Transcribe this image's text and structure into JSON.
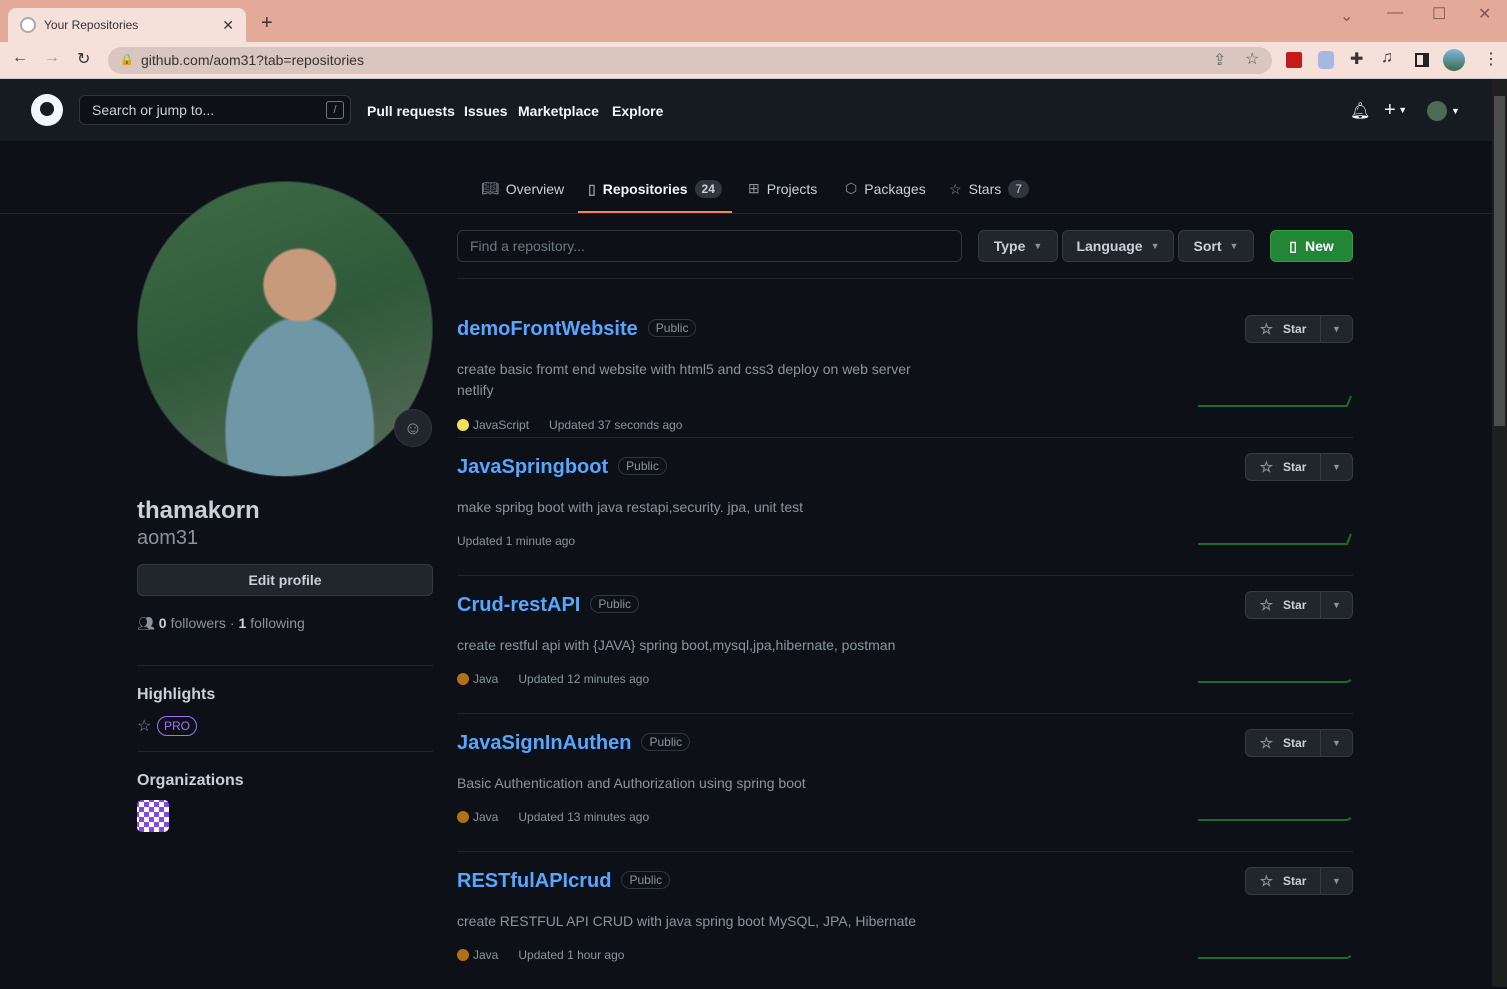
{
  "browser": {
    "tab_title": "Your Repositories",
    "url": "github.com/aom31?tab=repositories"
  },
  "header": {
    "search_placeholder": "Search or jump to...",
    "slash": "/",
    "nav": [
      "Pull requests",
      "Issues",
      "Marketplace",
      "Explore"
    ]
  },
  "profile_tabs": [
    {
      "label": "Overview"
    },
    {
      "label": "Repositories",
      "count": "24"
    },
    {
      "label": "Projects"
    },
    {
      "label": "Packages"
    },
    {
      "label": "Stars",
      "count": "7"
    }
  ],
  "filters": {
    "search_placeholder": "Find a repository...",
    "type": "Type",
    "language": "Language",
    "sort": "Sort",
    "new": "New"
  },
  "profile": {
    "name": "thamakorn",
    "login": "aom31",
    "edit": "Edit profile",
    "followers": "0",
    "followers_label": "followers",
    "sep": "·",
    "following": "1",
    "following_label": "following",
    "highlights": "Highlights",
    "pro": "PRO",
    "organizations": "Organizations"
  },
  "star_label": "Star",
  "public_label": "Public",
  "repos": [
    {
      "name": "demoFrontWebsite",
      "desc": "create basic fromt end website with html5 and css3 deploy on web server netlify",
      "language": "JavaScript",
      "lang_color": "#f1e05a",
      "updated": "Updated 37 seconds ago"
    },
    {
      "name": "JavaSpringboot",
      "desc": "make spribg boot with java restapi,security. jpa, unit test",
      "language": "",
      "lang_color": "",
      "updated": "Updated 1 minute ago"
    },
    {
      "name": "Crud-restAPI",
      "desc": "create restful api with {JAVA} spring boot,mysql,jpa,hibernate, postman",
      "language": "Java",
      "lang_color": "#b07219",
      "updated": "Updated 12 minutes ago"
    },
    {
      "name": "JavaSignInAuthen",
      "desc": "Basic Authentication and Authorization using spring boot",
      "language": "Java",
      "lang_color": "#b07219",
      "updated": "Updated 13 minutes ago"
    },
    {
      "name": "RESTfulAPIcrud",
      "desc": "create RESTFUL API CRUD with java spring boot MySQL, JPA, Hibernate",
      "language": "Java",
      "lang_color": "#b07219",
      "updated": "Updated 1 hour ago"
    }
  ]
}
